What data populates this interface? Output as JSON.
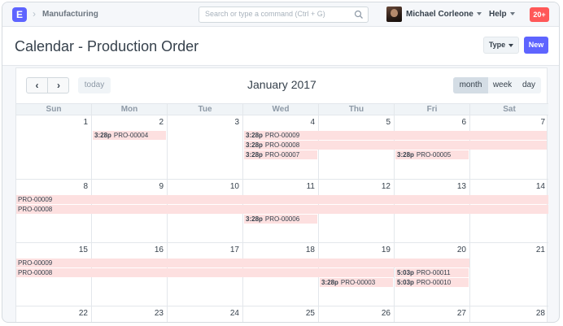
{
  "navbar": {
    "logo": "E",
    "breadcrumb": "Manufacturing",
    "search_placeholder": "Search or type a command (Ctrl + G)",
    "user_name": "Michael Corleone",
    "help_label": "Help",
    "notifications": "20+"
  },
  "page": {
    "title": "Calendar - Production Order",
    "type_button": "Type",
    "new_button": "New"
  },
  "calendar": {
    "prev_label": "‹",
    "next_label": "›",
    "today_label": "today",
    "title": "January 2017",
    "views": {
      "month": "month",
      "week": "week",
      "day": "day"
    },
    "active_view": "month",
    "weekdays": [
      "Sun",
      "Mon",
      "Tue",
      "Wed",
      "Thu",
      "Fri",
      "Sat"
    ],
    "weeks": [
      [
        "1",
        "2",
        "3",
        "4",
        "5",
        "6",
        "7"
      ],
      [
        "8",
        "9",
        "10",
        "11",
        "12",
        "13",
        "14"
      ],
      [
        "15",
        "16",
        "17",
        "18",
        "19",
        "20",
        "21"
      ],
      [
        "22",
        "23",
        "24",
        "25",
        "26",
        "27",
        "28"
      ]
    ],
    "events": [
      {
        "time": "3:28p",
        "name": "PRO-00004"
      },
      {
        "time": "3:28p",
        "name": "PRO-00009"
      },
      {
        "time": "3:28p",
        "name": "PRO-00008"
      },
      {
        "time": "3:28p",
        "name": "PRO-00007"
      },
      {
        "time": "3:28p",
        "name": "PRO-00005"
      },
      {
        "time": "",
        "name": "PRO-00009"
      },
      {
        "time": "",
        "name": "PRO-00008"
      },
      {
        "time": "3:28p",
        "name": "PRO-00006"
      },
      {
        "time": "",
        "name": "PRO-00009"
      },
      {
        "time": "",
        "name": "PRO-00008"
      },
      {
        "time": "5:03p",
        "name": "PRO-00011"
      },
      {
        "time": "3:28p",
        "name": "PRO-00003"
      },
      {
        "time": "5:03p",
        "name": "PRO-00010"
      }
    ]
  },
  "colors": {
    "accent": "#5e64ff",
    "event_bg": "#fde0e0",
    "badge": "#ff5858"
  }
}
